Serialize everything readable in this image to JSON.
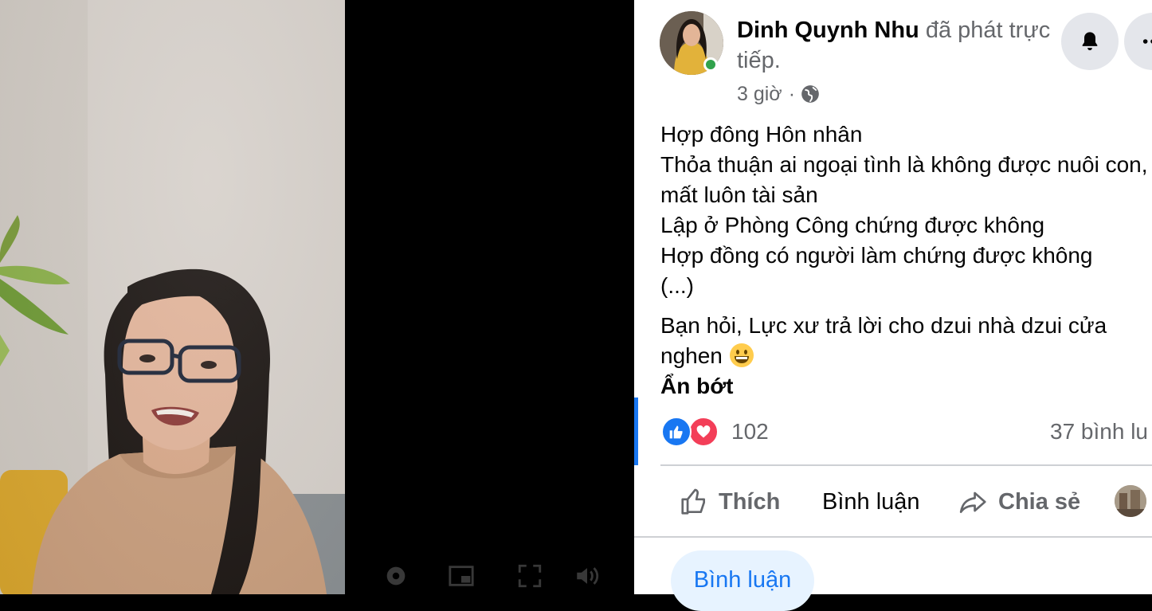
{
  "post": {
    "author": "Dinh Quynh Nhu",
    "action_text": "đã phát trực tiếp.",
    "time": "3 giờ",
    "separator": "·",
    "body_lines": [
      "Hợp đông Hôn nhân",
      "Thỏa thuận ai ngoại tình là không được nuôi con, mất luôn tài sản",
      "Lập ở Phòng Công chứng được không",
      "Hợp đồng có người làm chứng được không",
      "(...)"
    ],
    "body_paragraph2": "Bạn hỏi, Lực xư trả lời cho dzui nhà dzui cửa nghen",
    "see_less": "Ẩn bớt",
    "reaction_count": "102",
    "comment_count": "37 bình lu"
  },
  "actions": {
    "like": "Thích",
    "comment": "Bình luận",
    "share": "Chia sẻ"
  },
  "comment_button": "Bình luận",
  "icons": {
    "notify": "bell-icon",
    "more": "more-dots-icon",
    "audience": "globe-icon",
    "emoji": "grinning-face-emoji"
  },
  "colors": {
    "brand": "#1877f2",
    "online": "#31a24c",
    "love": "#f33e58",
    "secondary_text": "#65676b"
  }
}
